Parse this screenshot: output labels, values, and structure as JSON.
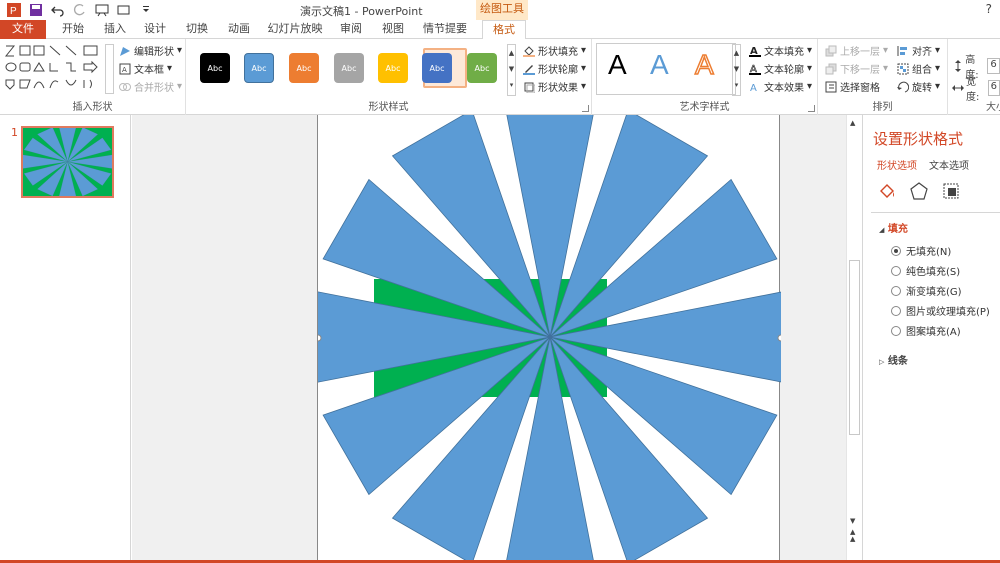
{
  "titlebar": {
    "title": "演示文稿1 - PowerPoint",
    "context_tag": "绘图工具",
    "help": "?"
  },
  "tabs": [
    "文件",
    "开始",
    "插入",
    "设计",
    "切换",
    "动画",
    "幻灯片放映",
    "审阅",
    "视图",
    "情节提要",
    "格式"
  ],
  "ribbon": {
    "insert_shapes": {
      "edit_shape": "编辑形状",
      "text_box": "文本框",
      "merge_shapes": "合并形状",
      "label": "插入形状"
    },
    "shape_styles": {
      "sample_text": "Abc",
      "colors": [
        "#000000",
        "#5b9bd5",
        "#ed7d31",
        "#a5a5a5",
        "#ffc000",
        "#4472c4",
        "#70ad47"
      ],
      "fill": "形状填充",
      "outline": "形状轮廓",
      "effects": "形状效果",
      "label": "形状样式"
    },
    "wordart": {
      "samples": [
        "A",
        "A",
        "A"
      ],
      "text_fill": "文本填充",
      "text_outline": "文本轮廓",
      "text_effects": "文本效果",
      "label": "艺术字样式"
    },
    "arrange": {
      "bring_forward": "上移一层",
      "send_backward": "下移一层",
      "selection_pane": "选择窗格",
      "align": "对齐",
      "group": "组合",
      "rotate": "旋转",
      "label": "排列"
    },
    "size": {
      "height_label": "高度:",
      "height_value": "6",
      "width_label": "宽度:",
      "width_value": "6",
      "label": "大小"
    }
  },
  "slides_pane": {
    "slide_number": "1"
  },
  "format_pane": {
    "title": "设置形状格式",
    "tab_shape": "形状选项",
    "tab_text": "文本选项",
    "fill_header": "填充",
    "fill_options": [
      "无填充(N)",
      "纯色填充(S)",
      "渐变填充(G)",
      "图片或纹理填充(P)",
      "图案填充(A)"
    ],
    "selected_fill": 0,
    "line_header": "线条"
  },
  "colors": {
    "accent": "#d24726",
    "shape_blue": "#5b9bd5",
    "shape_green": "#00b050"
  }
}
